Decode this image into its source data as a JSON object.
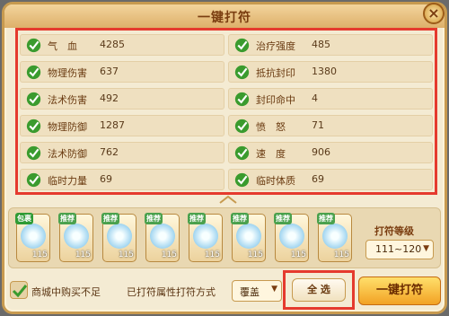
{
  "window": {
    "title": "一键打符",
    "close": "×"
  },
  "attributes": {
    "left": [
      {
        "label": "气　血",
        "value": "4285"
      },
      {
        "label": "物理伤害",
        "value": "637"
      },
      {
        "label": "法术伤害",
        "value": "492"
      },
      {
        "label": "物理防御",
        "value": "1287"
      },
      {
        "label": "法术防御",
        "value": "762"
      },
      {
        "label": "临时力量",
        "value": "69"
      }
    ],
    "right": [
      {
        "label": "治疗强度",
        "value": "485"
      },
      {
        "label": "抵抗封印",
        "value": "1380"
      },
      {
        "label": "封印命中",
        "value": "4"
      },
      {
        "label": "愤　怒",
        "value": "71"
      },
      {
        "label": "速　度",
        "value": "906"
      },
      {
        "label": "临时体质",
        "value": "69"
      }
    ]
  },
  "cards": [
    {
      "tag": "包裹",
      "level": "115"
    },
    {
      "tag": "推荐",
      "level": "115"
    },
    {
      "tag": "推荐",
      "level": "115"
    },
    {
      "tag": "推荐",
      "level": "115"
    },
    {
      "tag": "推荐",
      "level": "115"
    },
    {
      "tag": "推荐",
      "level": "115"
    },
    {
      "tag": "推荐",
      "level": "115"
    },
    {
      "tag": "推荐",
      "level": "115"
    }
  ],
  "level": {
    "label": "打符等级",
    "value": "111~120"
  },
  "footer": {
    "buy_text": "商城中购买不足",
    "mode_text": "已打符属性打符方式",
    "mode_value": "覆盖",
    "select_all": "全 选",
    "one_click": "一键打符"
  },
  "colors": {
    "accent": "#e53a2e",
    "check": "#3a9b2e"
  }
}
